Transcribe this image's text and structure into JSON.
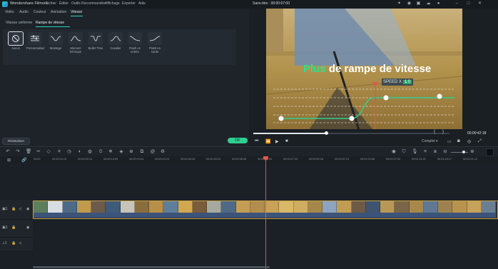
{
  "app": {
    "name": "Wondershare Filmora",
    "document_title": "Sans-titre : 00:00:07:00"
  },
  "menu": [
    "Fichier",
    "Éditer",
    "Outils Recommandés",
    "Affichage",
    "Exporter",
    "Aide"
  ],
  "tabs": [
    "Vidéo",
    "Audio",
    "Couleur",
    "Animation",
    "Vitesse"
  ],
  "active_tab": "Vitesse",
  "subtabs": [
    "Vitesse uniforme",
    "Rampe de vitesse"
  ],
  "active_subtab": "Rampe de vitesse",
  "presets": [
    {
      "label": "Aucun",
      "icon": "none-circle-icon"
    },
    {
      "label": "Personnaliser",
      "icon": "custom-sliders-icon"
    },
    {
      "label": "Montage",
      "icon": "montage-curve-icon"
    },
    {
      "label": "Moment héroïque",
      "icon": "hero-time-curve-icon"
    },
    {
      "label": "Bullet Time",
      "icon": "bullet-time-curve-icon"
    },
    {
      "label": "Cavalier",
      "icon": "jumper-curve-icon"
    },
    {
      "label": "Flash en entrée",
      "icon": "flash-in-curve-icon"
    },
    {
      "label": "Flash en sortie",
      "icon": "flash-out-curve-icon"
    }
  ],
  "buttons": {
    "reset": "Réinitialiser",
    "ok": "OK"
  },
  "preview": {
    "overlay_word1": "Plus",
    "overlay_rest": " de rampe de vitesse",
    "speed_label": "SPEED X",
    "speed_value": "1.0",
    "timecode": "00:00:42:18",
    "quality": "Complet",
    "progress_fraction": 0.37
  },
  "ruler_ticks": [
    "00:00",
    "00:00:04:19",
    "00:00:09:14",
    "00:00:14:09",
    "00:00:19:04",
    "00:00:23:23",
    "00:00:28:18",
    "00:00:33:13",
    "00:00:38:08",
    "00:00:43:04",
    "00:00:47:23",
    "00:00:52:18",
    "00:00:57:13",
    "00:01:02:08",
    "00:01:07:03",
    "00:01:11:22",
    "00:01:16:17",
    "00:01:21:12"
  ],
  "colors": {
    "accent": "#2ed3c1",
    "ok": "#2fcf8f",
    "playhead": "#e2574c",
    "clip_border": "#c7a449",
    "audio_wave": "#3c5479"
  }
}
